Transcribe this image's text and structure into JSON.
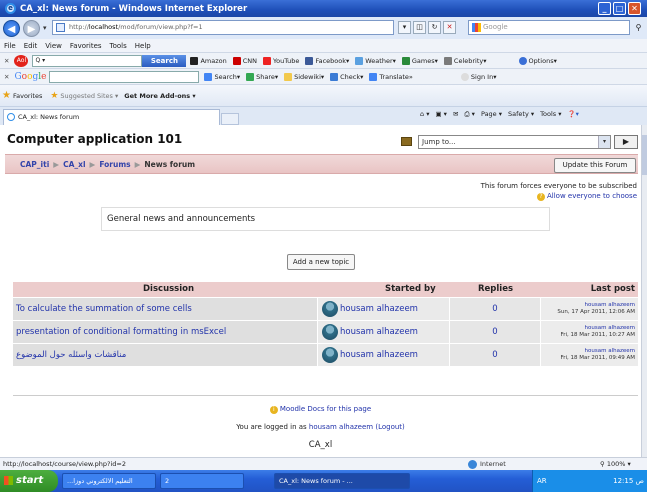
{
  "window": {
    "title": "CA_xl: News forum - Windows Internet Explorer"
  },
  "address": {
    "prefix": "http://",
    "host": "localhost",
    "path": "/mod/forum/view.php?f=1"
  },
  "search": {
    "placeholder": "Google"
  },
  "menu": [
    "File",
    "Edit",
    "View",
    "Favorites",
    "Tools",
    "Help"
  ],
  "aol": {
    "search_label": "Search",
    "items": [
      "Amazon",
      "CNN",
      "YouTube",
      "Facebook",
      "Weather",
      "Games",
      "Celebrity"
    ],
    "options": "Options"
  },
  "google": {
    "items": [
      "Search",
      "Share",
      "Sidewiki",
      "Check",
      "Translate"
    ],
    "signin": "Sign In"
  },
  "favorites": {
    "label": "Favorites",
    "suggested": "Suggested Sites ▾",
    "addons": "Get More Add-ons ▾"
  },
  "tab": {
    "label": "CA_xl: News forum"
  },
  "commands": [
    "Page ▾",
    "Safety ▾",
    "Tools ▾"
  ],
  "page": {
    "title": "Computer application 101",
    "jump_label": "Jump to...",
    "breadcrumb": [
      "CAP_iti",
      "CA_xl",
      "Forums",
      "News forum"
    ],
    "update_button": "Update this Forum",
    "subscribe_note": "This forum forces everyone to be subscribed",
    "allow_link": "Allow everyone to choose",
    "intro": "General news and announcements",
    "add_topic": "Add a new topic",
    "columns": [
      "Discussion",
      "Started by",
      "Replies",
      "Last post"
    ],
    "rows": [
      {
        "discussion": "To calculate the summation of some cells",
        "started_by": "housam alhazeem",
        "replies": "0",
        "last_user": "housam alhazeem",
        "last_date": "Sun, 17 Apr 2011, 12:06 AM"
      },
      {
        "discussion": "presentation of conditional formatting in msExcel",
        "started_by": "housam alhazeem",
        "replies": "0",
        "last_user": "housam alhazeem",
        "last_date": "Fri, 18 Mar 2011, 10:27 AM"
      },
      {
        "discussion": "مناقشات واسئله حول الموضوع",
        "started_by": "housam alhazeem",
        "replies": "0",
        "last_user": "housam alhazeem",
        "last_date": "Fri, 18 Mar 2011, 09:49 AM"
      }
    ],
    "docs_link": "Moodle Docs for this page",
    "logged_prefix": "You are logged in as",
    "logged_user": "housam alhazeem",
    "logout": "(Logout)",
    "footer_course": "CA_xl"
  },
  "status": {
    "url": "http://localhost/course/view.php?id=2",
    "zone": "Internet",
    "zoom": "100%"
  },
  "taskbar": {
    "start": "start",
    "tasks": [
      "...التعليم الالكتروني دوزا",
      "2",
      "CA_xl: News forum - ..."
    ],
    "lang": "AR",
    "clock": "12:15 ص"
  }
}
